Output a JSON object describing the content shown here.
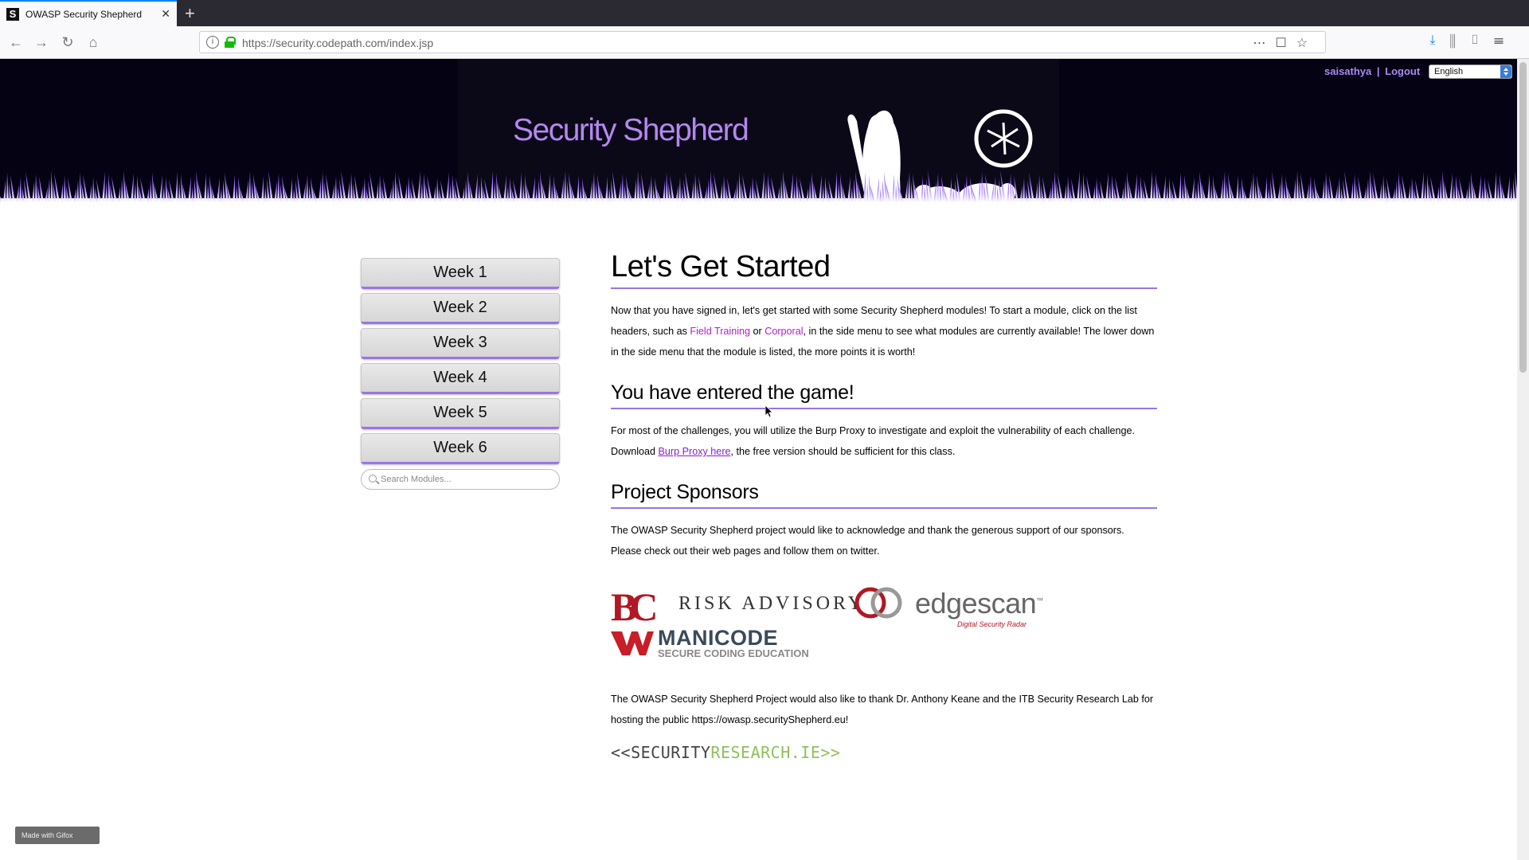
{
  "browser": {
    "tab_title": "OWASP Security Shepherd",
    "tab_favicon": "S",
    "url": "https://security.codepath.com/index.jsp"
  },
  "header": {
    "site_title": "Security Shepherd",
    "username": "saisathya",
    "separator": "|",
    "logout": "Logout",
    "language": "English"
  },
  "sidebar": {
    "weeks": [
      "Week 1",
      "Week 2",
      "Week 3",
      "Week 4",
      "Week 5",
      "Week 6"
    ],
    "search_placeholder": "Search Modules..."
  },
  "main": {
    "title": "Let's Get Started",
    "intro": {
      "before": "Now that you have signed in, let's get started with some Security Shepherd modules! To start a module, click on the list headers, such as ",
      "field_training": "Field Training",
      "or": " or ",
      "corporal": "Corporal",
      "after": ", in the side menu to see what modules are currently available! The lower down in the side menu that the module is listed, the more points it is worth!"
    },
    "game_heading": "You have entered the game!",
    "game_text": {
      "before": "For most of the challenges, you will utilize the Burp Proxy to investigate and exploit the vulnerability of each challenge. Download ",
      "link": "Burp Proxy here",
      "after": ", the free version should be sufficient for this class."
    },
    "sponsors_heading": "Project Sponsors",
    "sponsors_text": "The OWASP Security Shepherd project would like to acknowledge and thank the generous support of our sponsors. Please check out their web pages and follow them on twitter.",
    "sponsor_logos": {
      "bc": "BC",
      "risk": "RISK ADVISORY",
      "edgescan": "edgescan",
      "edgescan_tm": "™",
      "edgescan_tag": "Digital Security Radar",
      "manicode": "MANICODE",
      "manicode_sub": "SECURE CODING EDUCATION"
    },
    "thanks_text": "The OWASP Security Shepherd Project would also like to thank Dr. Anthony Keane and the ITB Security Research Lab for hosting the public https://owasp.securityShepherd.eu!",
    "secres_logo": {
      "part1": "<<SECURITY",
      "part2": "RESEARCH.IE>>"
    }
  },
  "overlay": {
    "gifox": "Made with Gifox"
  }
}
